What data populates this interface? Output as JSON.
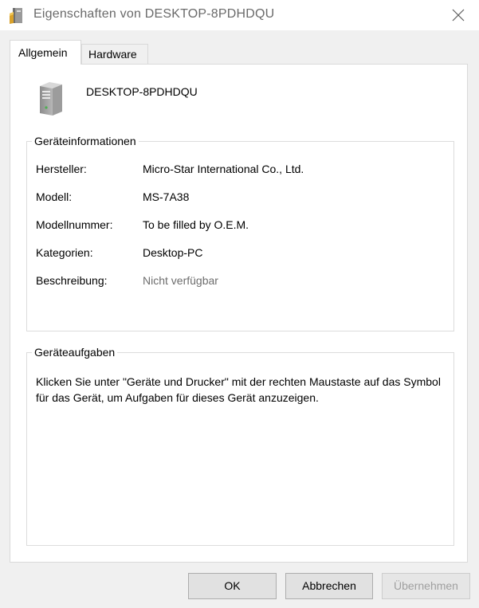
{
  "window": {
    "title": "Eigenschaften von DESKTOP-8PDHDQU",
    "icon": "properties-icon",
    "close_icon": "close-icon"
  },
  "tabs": [
    {
      "label": "Allgemein",
      "active": true
    },
    {
      "label": "Hardware",
      "active": false
    }
  ],
  "device": {
    "icon": "computer-tower-icon",
    "name": "DESKTOP-8PDHDQU"
  },
  "device_info": {
    "group_title": "Geräteinformationen",
    "rows": [
      {
        "label": "Hersteller:",
        "value": "Micro-Star International Co., Ltd."
      },
      {
        "label": "Modell:",
        "value": "MS-7A38"
      },
      {
        "label": "Modellnummer:",
        "value": "To be filled by O.E.M."
      },
      {
        "label": "Kategorien:",
        "value": "Desktop-PC"
      },
      {
        "label": "Beschreibung:",
        "value": "Nicht verfügbar"
      }
    ]
  },
  "device_tasks": {
    "group_title": "Geräteaufgaben",
    "text": "Klicken Sie unter \"Geräte und Drucker\" mit der rechten Maustaste auf das Symbol für das Gerät, um Aufgaben für dieses Gerät anzuzeigen."
  },
  "buttons": {
    "ok": "OK",
    "cancel": "Abbrechen",
    "apply": "Übernehmen"
  },
  "colors": {
    "window_bg": "#f0f0f0",
    "panel_bg": "#ffffff",
    "muted_text": "#6d6d6d",
    "disabled_text": "#a0a0a0"
  }
}
